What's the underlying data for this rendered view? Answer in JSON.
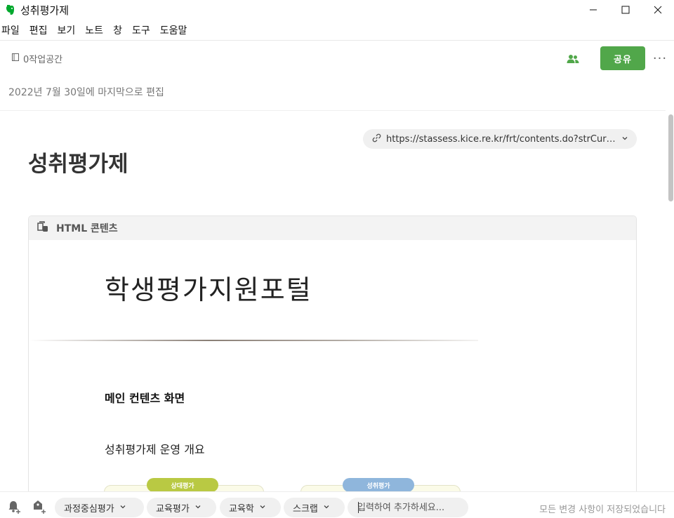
{
  "window": {
    "title": "성취평가제",
    "controls": {
      "minimize": "—",
      "maximize": "☐",
      "close": "✕"
    }
  },
  "menu": [
    "파일",
    "편집",
    "보기",
    "노트",
    "창",
    "도구",
    "도움말"
  ],
  "header": {
    "workspace": "0작업공간",
    "share_label": "공유",
    "more_label": "···",
    "last_edited": "2022년 7월 30일에 마지막으로 편집"
  },
  "note": {
    "source_url": "https://stassess.kice.re.kr/frt/contents.do?strCurMenuId=",
    "title": "성취평가제",
    "html_block": {
      "label": "HTML 콘텐츠",
      "portal_title": "학생평가지원포털",
      "section_heading": "메인 컨텐츠 화면",
      "section_text": "성취평가제 운영 개요",
      "diagram_tags": [
        {
          "label": "상대평가",
          "color": "#b9c943"
        },
        {
          "label": "성취평가",
          "color": "#8fb6dc"
        }
      ]
    }
  },
  "footer": {
    "tags": [
      "과정중심평가",
      "교육평가",
      "교육학",
      "스크랩"
    ],
    "tag_input_placeholder": "입력하여 추가하세요...",
    "save_status": "모든 변경 사항이 저장되었습니다"
  },
  "colors": {
    "accent": "#51a74a",
    "brand": "#00a82d"
  },
  "icons": {
    "app": "evernote-elephant-icon",
    "workspace": "notebook-icon",
    "people": "people-icon",
    "link": "link-icon",
    "html": "html-content-icon",
    "reminder": "bell-plus-icon",
    "tag": "tag-plus-icon"
  }
}
